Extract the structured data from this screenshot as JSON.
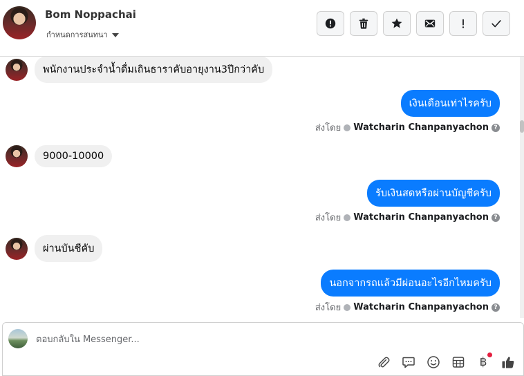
{
  "header": {
    "contact_name": "Bom Noppachai",
    "label_selector": "กำหนดการสนทนา",
    "actions": [
      {
        "name": "mark-spam-button",
        "icon": "alert-circle-icon"
      },
      {
        "name": "delete-button",
        "icon": "trash-icon"
      },
      {
        "name": "star-button",
        "icon": "star-icon"
      },
      {
        "name": "mark-unread-button",
        "icon": "envelope-icon"
      },
      {
        "name": "follow-up-button",
        "icon": "exclamation-icon"
      },
      {
        "name": "mark-done-button",
        "icon": "check-icon"
      }
    ]
  },
  "messages": [
    {
      "direction": "in",
      "text": "พนักงานประจำน้ำดื่มเถินธาราคับอายุงาน3ปีกว่าคับ"
    },
    {
      "direction": "out",
      "text": "เงินเดือนเท่าไรครับ",
      "sent_by_label": "ส่งโดย",
      "sender": "Watcharin Chanpanyachon"
    },
    {
      "direction": "in",
      "text": "9000-10000"
    },
    {
      "direction": "out",
      "text": "รับเงินสดหรือผ่านบัญชีครับ",
      "sent_by_label": "ส่งโดย",
      "sender": "Watcharin Chanpanyachon"
    },
    {
      "direction": "in",
      "text": "ผ่านบันชีคับ"
    },
    {
      "direction": "out",
      "text": "นอกจากรถแล้วมีผ่อนอะไรอีกไหมครับ",
      "sent_by_label": "ส่งโดย",
      "sender": "Watcharin Chanpanyachon"
    }
  ],
  "composer": {
    "placeholder": "ตอบกลับใน Messenger...",
    "value": "",
    "tools": [
      "paperclip-icon",
      "chat-bubble-icon",
      "smile-icon",
      "table-icon",
      "baht-icon",
      "thumbs-up-icon"
    ]
  },
  "colors": {
    "outgoing_bubble": "#0a7cff",
    "incoming_bubble": "#f0f0f0",
    "notification_dot": "#e41e3f"
  }
}
